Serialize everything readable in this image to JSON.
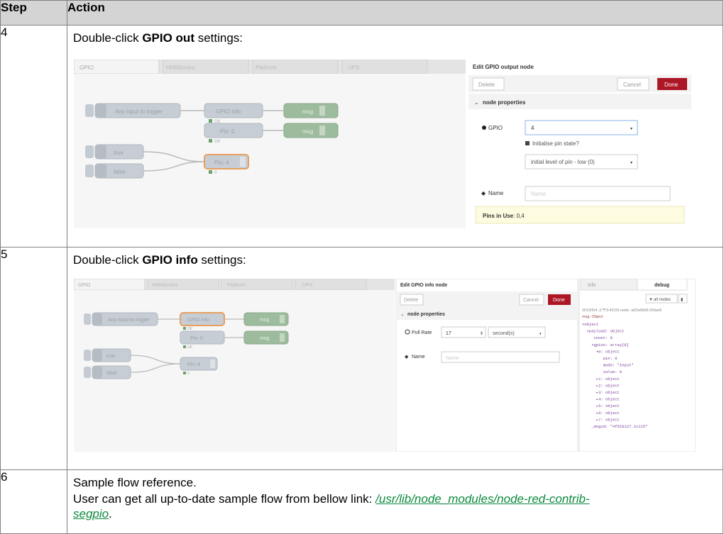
{
  "header": {
    "step": "Step",
    "action": "Action"
  },
  "rows": [
    {
      "step": "4",
      "pre": "Double-click ",
      "bold": "GPIO out",
      "post": " settings:"
    },
    {
      "step": "5",
      "pre": "Double-click ",
      "bold": "GPIO info",
      "post": " settings:"
    },
    {
      "step": "6",
      "line1": "Sample flow reference.",
      "line2_pre": "User can get all up-to-date sample flow from bellow link: ",
      "link": "/usr/lib/node_modules/node-red-contrib-segpio",
      "link_part1": "/usr/lib/node_modules/node-red-contrib-",
      "link_part2": "segpio",
      "line2_post": "."
    }
  ],
  "shot1": {
    "tabs": [
      "GPIO",
      "HMIMonitor",
      "Platform",
      "UPS"
    ],
    "nodes": {
      "inject1": "Any input to trigger",
      "info": "GPIO info",
      "msg": "msg",
      "pin0": "Pin: 0",
      "true": "true",
      "false": "false",
      "pin4": "Pin: 4",
      "ok": "OK",
      "zero": "0"
    },
    "panel": {
      "title": "Edit GPIO output node",
      "delete": "Delete",
      "cancel": "Cancel",
      "done": "Done",
      "section": "node properties",
      "gpio_label": "GPIO",
      "gpio_value": "4",
      "init_label": "Initialise pin state?",
      "init_level": "initial level of pin - low (0)",
      "name_label": "Name",
      "name_placeholder": "Name",
      "pins_label": "Pins in Use",
      "pins_value": ": 0,4"
    }
  },
  "shot2": {
    "tabs": [
      "GPIO",
      "HMIMonitor",
      "Platform",
      "UPS"
    ],
    "nodes": {
      "inject1": "Any input to trigger",
      "info": "GPIO info",
      "msg": "msg",
      "pin0": "Pin: 0",
      "true": "true",
      "false": "false",
      "pin4": "Pin: 4",
      "ok": "OK",
      "zero": "0"
    },
    "panel": {
      "title": "Edit GPIO info node",
      "delete": "Delete",
      "cancel": "Cancel",
      "done": "Done",
      "section": "node properties",
      "poll_label": "Poll Rate",
      "poll_value": "17",
      "unit": "second(s)",
      "name_label": "Name",
      "name_placeholder": "Name"
    },
    "debug": {
      "tab_info": "info",
      "tab_debug": "debug",
      "all_nodes": "all nodes",
      "meta": "2019/5/4 上午9:40:59  node: a02a58d6.f29ae8",
      "type": "msg: Object",
      "tree": [
        "▾object",
        "  ▾payload: object",
        "     count: 8",
        "    ▾gpios: array[8]",
        "      ▾0: object",
        "         pin: 0",
        "         mode: \"Input\"",
        "         value: 0",
        "      ▸1: object",
        "      ▸2: object",
        "      ▸3: object",
        "      ▸4: object",
        "      ▸5: object",
        "      ▸6: object",
        "      ▸7: object",
        "    _msgid: \"4f51b127.1c115\""
      ]
    }
  }
}
